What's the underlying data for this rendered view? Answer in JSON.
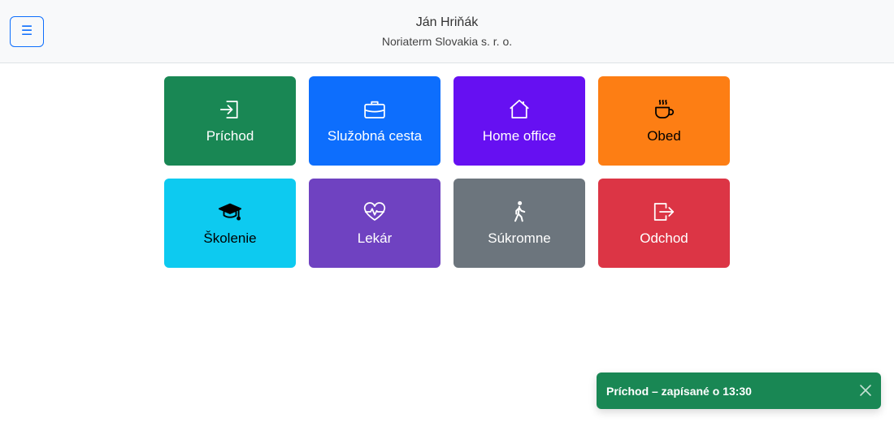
{
  "header": {
    "menu_icon": "hamburger-icon",
    "user_name": "Ján Hriňák",
    "company": "Noriaterm Slovakia s. r. o."
  },
  "tiles": [
    {
      "label": "Príchod",
      "icon": "login-icon",
      "bg": "#198754",
      "fg": "#ffffff"
    },
    {
      "label": "Služobná cesta",
      "icon": "briefcase-icon",
      "bg": "#0d6efd",
      "fg": "#ffffff"
    },
    {
      "label": "Home office",
      "icon": "house-icon",
      "bg": "#6610f2",
      "fg": "#ffffff"
    },
    {
      "label": "Obed",
      "icon": "coffee-cup-icon",
      "bg": "#fd7e14",
      "fg": "#000000"
    },
    {
      "label": "Školenie",
      "icon": "graduation-cap-icon",
      "bg": "#0dcaf0",
      "fg": "#000000"
    },
    {
      "label": "Lekár",
      "icon": "heart-pulse-icon",
      "bg": "#6f42c1",
      "fg": "#ffffff"
    },
    {
      "label": "Súkromne",
      "icon": "person-walking-icon",
      "bg": "#6c757d",
      "fg": "#ffffff"
    },
    {
      "label": "Odchod",
      "icon": "logout-icon",
      "bg": "#dc3545",
      "fg": "#ffffff"
    }
  ],
  "toast": {
    "message": "Príchod – zapísané o 13:30",
    "bg": "#198754",
    "close_icon": "close-icon"
  }
}
